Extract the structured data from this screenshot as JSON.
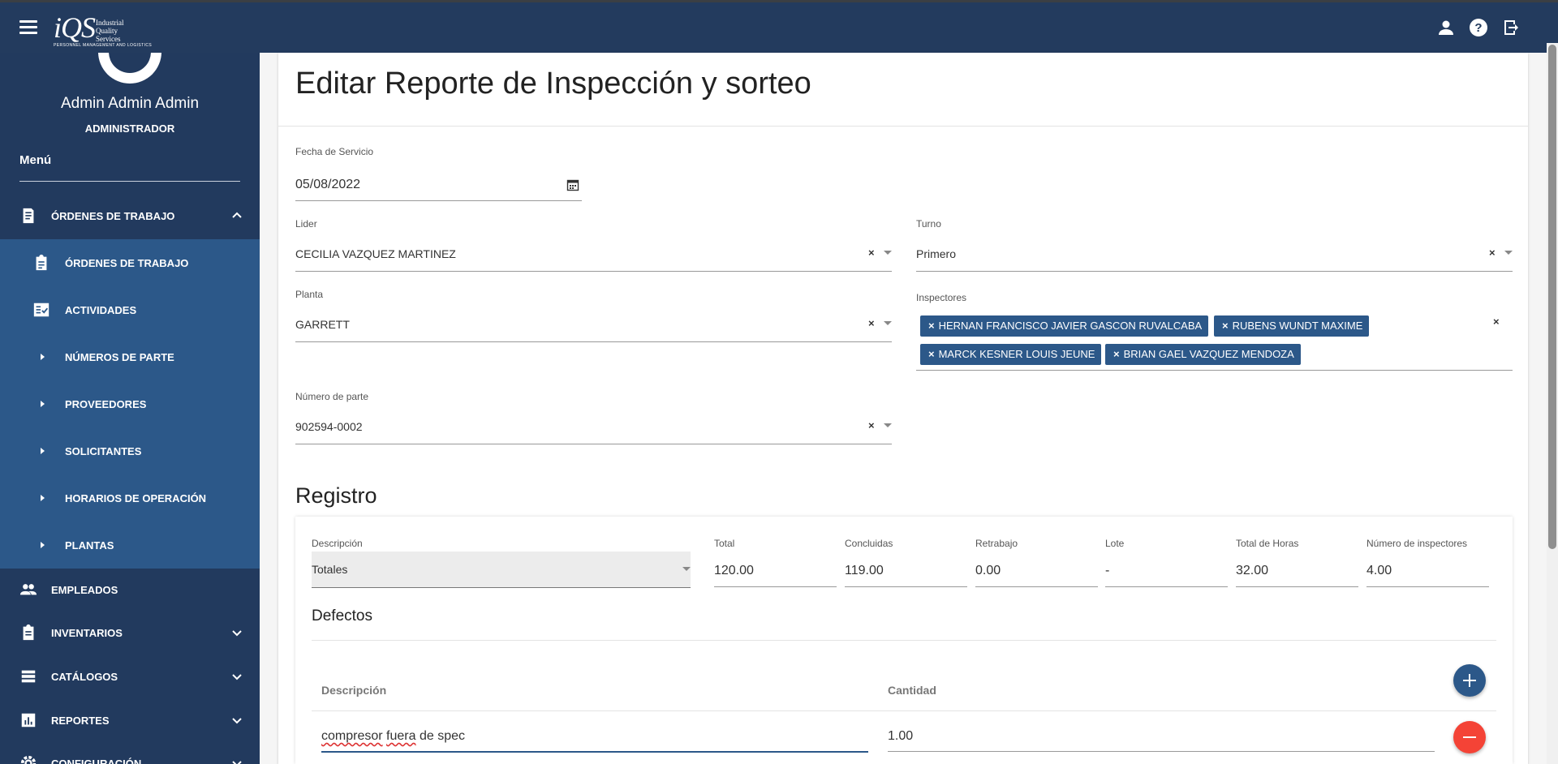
{
  "header": {
    "logo_text": "iQS",
    "logo_company": "Industrial Quality Services",
    "logo_tagline": "PERSONNEL MANAGEMENT AND LOGISTICS"
  },
  "sidebar": {
    "user_name": "Admin Admin Admin",
    "user_role": "ADMINISTRADOR",
    "menu_title": "Menú",
    "items": [
      {
        "label": "ÓRDENES DE TRABAJO"
      },
      {
        "label": "ÓRDENES DE TRABAJO"
      },
      {
        "label": "ACTIVIDADES"
      },
      {
        "label": "NÚMEROS DE PARTE"
      },
      {
        "label": "PROVEEDORES"
      },
      {
        "label": "SOLICITANTES"
      },
      {
        "label": "HORARIOS DE OPERACIÓN"
      },
      {
        "label": "PLANTAS"
      },
      {
        "label": "EMPLEADOS"
      },
      {
        "label": "INVENTARIOS"
      },
      {
        "label": "CATÁLOGOS"
      },
      {
        "label": "REPORTES"
      },
      {
        "label": "CONFIGURACIÓN"
      }
    ]
  },
  "form": {
    "title": "Editar Reporte de Inspección y sorteo",
    "fecha_label": "Fecha de Servicio",
    "fecha_value": "05/08/2022",
    "lider_label": "Lider",
    "lider_value": "CECILIA VAZQUEZ MARTINEZ",
    "turno_label": "Turno",
    "turno_value": "Primero",
    "planta_label": "Planta",
    "planta_value": "GARRETT",
    "inspectores_label": "Inspectores",
    "inspectores": [
      "HERNAN FRANCISCO JAVIER GASCON RUVALCABA",
      "RUBENS WUNDT MAXIME",
      "MARCK KESNER LOUIS JEUNE",
      "BRIAN GAEL VAZQUEZ MENDOZA"
    ],
    "numparte_label": "Número de parte",
    "numparte_value": "902594-0002",
    "clear_glyph": "×"
  },
  "registro": {
    "title": "Registro",
    "descripcion_label": "Descripción",
    "descripcion_value": "Totales",
    "total_label": "Total",
    "total_value": "120.00",
    "concluidas_label": "Concluidas",
    "concluidas_value": "119.00",
    "retrabajo_label": "Retrabajo",
    "retrabajo_value": "0.00",
    "lote_label": "Lote",
    "lote_value": "-",
    "horas_label": "Total de Horas",
    "horas_value": "32.00",
    "inspectores_label": "Número de inspectores",
    "inspectores_value": "4.00"
  },
  "defectos": {
    "title": "Defectos",
    "col_descripcion": "Descripción",
    "col_cantidad": "Cantidad",
    "rows": [
      {
        "w1": "compresor",
        "w2": "fuera",
        "w3": "de spec",
        "cantidad": "1.00"
      }
    ]
  },
  "colors": {
    "header_bg": "#233b5e",
    "sidebar_bg": "#223a5e",
    "submenu_bg": "#2c5889",
    "chip_bg": "#2c5889",
    "add_button": "#2c5889",
    "remove_button": "#f44336"
  },
  "icons": [
    "menu-icon",
    "person-icon",
    "help-icon",
    "logout-icon",
    "receipt-icon",
    "clipboard-icon",
    "checklist-icon",
    "play-arrow-icon",
    "people-icon",
    "list-icon",
    "bar-chart-icon",
    "gear-icon",
    "chevron-up-icon",
    "chevron-down-icon",
    "calendar-icon",
    "plus-icon",
    "minus-icon"
  ]
}
